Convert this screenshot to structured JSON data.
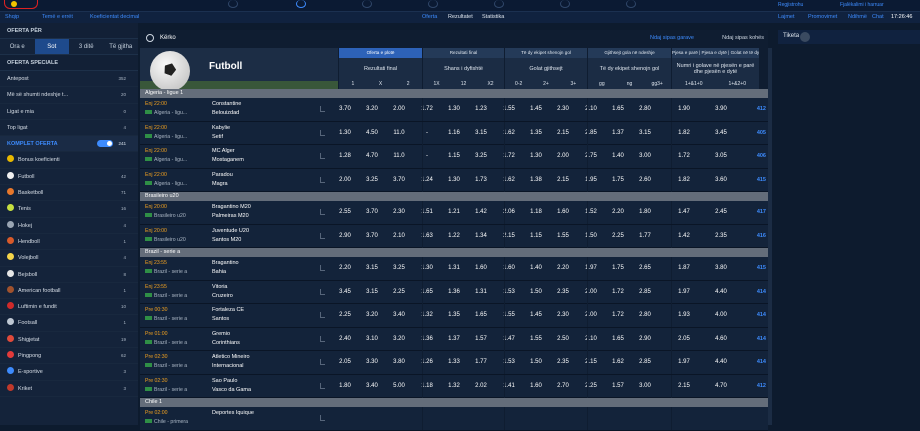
{
  "topbar": {
    "right_links": [
      "Regjistrohu",
      "Fjalëkalimi i harruar"
    ]
  },
  "subbar": {
    "left": [
      "Shqip",
      "Temë e errët",
      "Koeficientat decimal"
    ],
    "center": [
      "Oferta",
      "Rezultatet",
      "Statistika"
    ],
    "right": [
      "Lajmet",
      "Promovimet",
      "Ndihmë",
      "Chat"
    ],
    "time": "17:26:46"
  },
  "sidebar": {
    "header": "OFERTA PËR",
    "tabs": [
      "Ora e",
      "Sot",
      "3 ditë",
      "Të gjitha"
    ],
    "active_tab": "Sot",
    "special_header": "OFERTA SPECIALE",
    "special": [
      {
        "label": "Antepost",
        "count": "352"
      },
      {
        "label": "Më së shumti ndeshje t...",
        "count": "20"
      },
      {
        "label": "Ligat e mia",
        "count": "0"
      },
      {
        "label": "Top ligat",
        "count": "4"
      }
    ],
    "komplet": {
      "label": "KOMPLET OFERTA",
      "count": "241"
    },
    "sports": [
      {
        "label": "Bonus koeficienti",
        "count": "",
        "color": "#e8b800"
      },
      {
        "label": "Futboll",
        "count": "42",
        "color": "#f0f0f0"
      },
      {
        "label": "Basketboll",
        "count": "71",
        "color": "#e8782b"
      },
      {
        "label": "Tenis",
        "count": "16",
        "color": "#c6e040"
      },
      {
        "label": "Hokej",
        "count": "4",
        "color": "#9aa5b3"
      },
      {
        "label": "Hendboll",
        "count": "1",
        "color": "#d85a2a"
      },
      {
        "label": "Volejboll",
        "count": "4",
        "color": "#f5d54a"
      },
      {
        "label": "Bejsboll",
        "count": "8",
        "color": "#e6e6e6"
      },
      {
        "label": "American football",
        "count": "1",
        "color": "#a0522d"
      },
      {
        "label": "Luftimin e fundit",
        "count": "10",
        "color": "#d02a2a"
      },
      {
        "label": "Footsall",
        "count": "1",
        "color": "#bfc8d3"
      },
      {
        "label": "Shigjetat",
        "count": "19",
        "color": "#e04a3a"
      },
      {
        "label": "Pingpong",
        "count": "62",
        "color": "#e23a3a"
      },
      {
        "label": "E-sportive",
        "count": "3",
        "color": "#3d8bfd"
      },
      {
        "label": "Kriket",
        "count": "3",
        "color": "#c0392b"
      }
    ]
  },
  "search": {
    "query": "Kërko",
    "bets_link": "Ndaj sipas garave",
    "time_link": "Ndaj sipas kohës"
  },
  "banner": {
    "sport": "Futboll"
  },
  "markets": [
    {
      "tab": "Oferta e plotë",
      "title": "Rezultati final",
      "cols": [
        "1",
        "X",
        "2"
      ]
    },
    {
      "tab": "Rezultati final",
      "title": "Shans i dyfishtë",
      "cols": [
        "1X",
        "12",
        "X2"
      ]
    },
    {
      "tab": "Të dy ekipet shenojn gol",
      "title": "Golat gjithsejt",
      "cols": [
        "0-2",
        "2+",
        "3+"
      ]
    },
    {
      "tab": "Gjithsejt gola në ndeshje",
      "title": "Të dy ekipet shenojn gol",
      "cols": [
        "gg",
        "ng",
        "gg3+"
      ]
    },
    {
      "tab": "Pjesa e parë | Pjesa e dytë | Golat në të dy pjesët | Shenon gol",
      "title": "Numri i golave në pjesën e parë dhe pjesën e dytë",
      "cols": [
        "1+&1+0",
        "1+&2+0"
      ]
    }
  ],
  "leagues": [
    {
      "name": "Algeria - ligue 1",
      "matches": [
        {
          "time": "Enj 22:00",
          "league": "Algeria - ligu...",
          "home": "Constantine",
          "away": "Belouizdad",
          "odds": [
            "3.70",
            "3.20",
            "2.00",
            "1.72",
            "1.30",
            "1.23",
            "1.55",
            "1.45",
            "2.30",
            "2.10",
            "1.65",
            "2.80",
            "1.90",
            "3.90"
          ],
          "more": "412"
        },
        {
          "time": "Enj 22:00",
          "league": "Algeria - ligu...",
          "home": "Kabylie",
          "away": "Setif",
          "odds": [
            "1.30",
            "4.50",
            "11.0",
            "-",
            "1.16",
            "3.15",
            "1.62",
            "1.35",
            "2.15",
            "2.85",
            "1.37",
            "3.15",
            "1.82",
            "3.45"
          ],
          "more": "405"
        },
        {
          "time": "Enj 22:00",
          "league": "Algeria - ligu...",
          "home": "MC Alger",
          "away": "Mostaganem",
          "odds": [
            "1.28",
            "4.70",
            "11.0",
            "-",
            "1.15",
            "3.25",
            "1.72",
            "1.30",
            "2.00",
            "2.75",
            "1.40",
            "3.00",
            "1.72",
            "3.05"
          ],
          "more": "406"
        },
        {
          "time": "Enj 22:00",
          "league": "Algeria - ligu...",
          "home": "Paradou",
          "away": "Magra",
          "odds": [
            "2.00",
            "3.25",
            "3.70",
            "1.24",
            "1.30",
            "1.73",
            "1.62",
            "1.38",
            "2.15",
            "1.95",
            "1.75",
            "2.60",
            "1.82",
            "3.60"
          ],
          "more": "415"
        }
      ]
    },
    {
      "name": "Brasileiro u20",
      "matches": [
        {
          "time": "Enj 20:00",
          "league": "Brasileiro u20",
          "home": "Bragantino M20",
          "away": "Palmeiras M20",
          "odds": [
            "2.55",
            "3.70",
            "2.30",
            "1.51",
            "1.21",
            "1.42",
            "2.06",
            "1.18",
            "1.60",
            "1.52",
            "2.20",
            "1.80",
            "1.47",
            "2.45"
          ],
          "more": "417"
        },
        {
          "time": "Enj 20:00",
          "league": "Brasileiro u20",
          "home": "Juventude U20",
          "away": "Santos M20",
          "odds": [
            "2.90",
            "3.70",
            "2.10",
            "1.63",
            "1.22",
            "1.34",
            "2.15",
            "1.15",
            "1.55",
            "1.50",
            "2.25",
            "1.77",
            "1.42",
            "2.35"
          ],
          "more": "416"
        }
      ]
    },
    {
      "name": "Brazil - serie a",
      "matches": [
        {
          "time": "Enj 23:55",
          "league": "Brazil - serie a",
          "home": "Bragantino",
          "away": "Bahia",
          "odds": [
            "2.20",
            "3.15",
            "3.25",
            "1.30",
            "1.31",
            "1.60",
            "1.60",
            "1.40",
            "2.20",
            "1.97",
            "1.75",
            "2.65",
            "1.87",
            "3.80"
          ],
          "more": "415"
        },
        {
          "time": "Enj 23:55",
          "league": "Brazil - serie a",
          "home": "Vitoria",
          "away": "Cruzeiro",
          "odds": [
            "3.45",
            "3.15",
            "2.25",
            "1.65",
            "1.36",
            "1.31",
            "1.53",
            "1.50",
            "2.35",
            "2.00",
            "1.72",
            "2.85",
            "1.97",
            "4.40"
          ],
          "more": "414"
        },
        {
          "time": "Pre 00:30",
          "league": "Brazil - serie a",
          "home": "Fortaleza CE",
          "away": "Santos",
          "odds": [
            "2.25",
            "3.20",
            "3.40",
            "1.32",
            "1.35",
            "1.65",
            "1.55",
            "1.45",
            "2.30",
            "2.00",
            "1.72",
            "2.80",
            "1.93",
            "4.00"
          ],
          "more": "414"
        },
        {
          "time": "Pre 01:00",
          "league": "Brazil - serie a",
          "home": "Gremio",
          "away": "Corinthians",
          "odds": [
            "2.40",
            "3.10",
            "3.20",
            "1.36",
            "1.37",
            "1.57",
            "1.47",
            "1.55",
            "2.50",
            "2.10",
            "1.65",
            "2.90",
            "2.05",
            "4.60"
          ],
          "more": "414"
        },
        {
          "time": "Pre 02:30",
          "league": "Brazil - serie a",
          "home": "Atletico Mineiro",
          "away": "Internacional",
          "odds": [
            "2.05",
            "3.30",
            "3.80",
            "1.26",
            "1.33",
            "1.77",
            "1.53",
            "1.50",
            "2.35",
            "2.15",
            "1.62",
            "2.85",
            "1.97",
            "4.40"
          ],
          "more": "414"
        },
        {
          "time": "Pre 02:30",
          "league": "Brazil - serie a",
          "home": "Sao Paulo",
          "away": "Vasco da Gama",
          "odds": [
            "1.80",
            "3.40",
            "5.00",
            "1.18",
            "1.32",
            "2.02",
            "1.41",
            "1.60",
            "2.70",
            "2.25",
            "1.57",
            "3.00",
            "2.15",
            "4.70"
          ],
          "more": "412"
        }
      ]
    },
    {
      "name": "Chile 1",
      "matches": [
        {
          "time": "Pre 02:00",
          "league": "Chile - primera",
          "home": "Deportes Iquique",
          "away": "",
          "odds": [
            "",
            "",
            "",
            "",
            "",
            "",
            "",
            "",
            "",
            "",
            "",
            "",
            "",
            ""
          ],
          "more": ""
        }
      ]
    }
  ],
  "ticket": {
    "label": "Tiketa"
  }
}
